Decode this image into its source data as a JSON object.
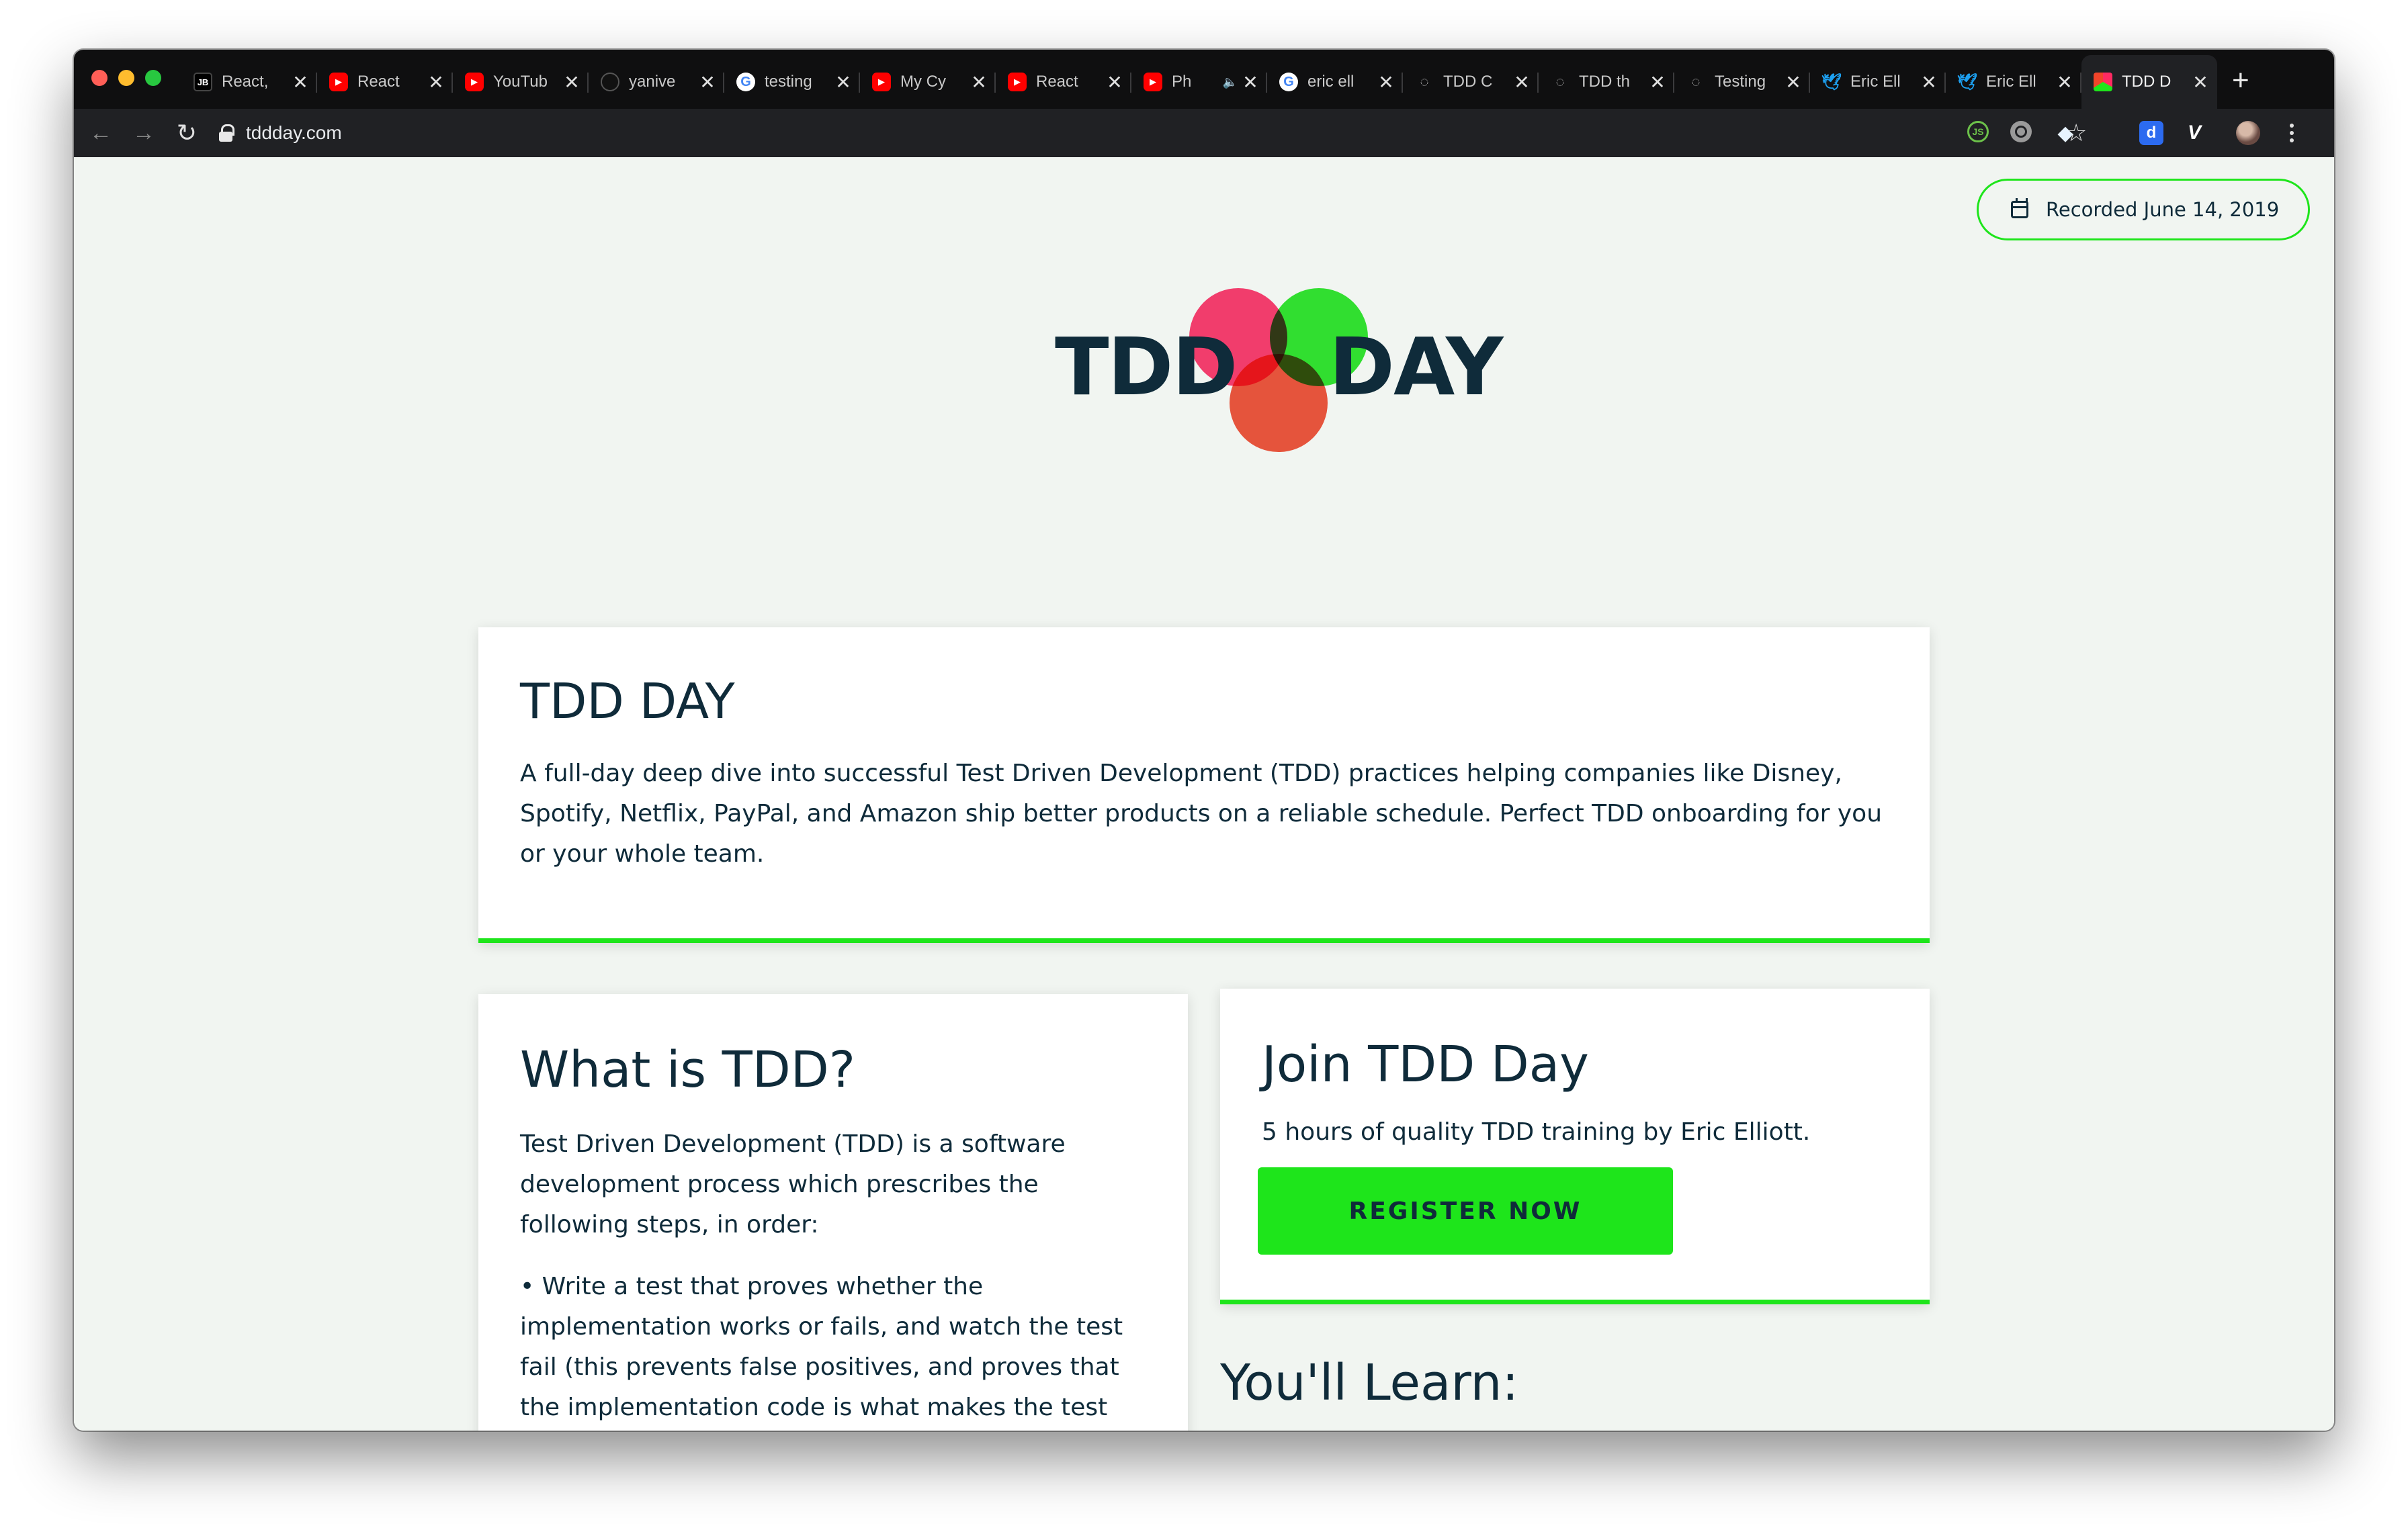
{
  "browser": {
    "tabs": [
      {
        "label": "React,",
        "favicon": "jetbrains-icon",
        "active": false
      },
      {
        "label": "React",
        "favicon": "youtube-icon",
        "active": false
      },
      {
        "label": "YouTub",
        "favicon": "youtube-icon",
        "active": false
      },
      {
        "label": "yanive",
        "favicon": "github-icon",
        "active": false
      },
      {
        "label": "testing",
        "favicon": "google-icon",
        "active": false
      },
      {
        "label": "My Cy",
        "favicon": "youtube-icon",
        "active": false
      },
      {
        "label": "React",
        "favicon": "youtube-icon",
        "active": false
      },
      {
        "label": "Ph",
        "favicon": "youtube-icon",
        "active": false,
        "audio": true
      },
      {
        "label": "eric ell",
        "favicon": "google-icon",
        "active": false
      },
      {
        "label": "TDD C",
        "favicon": "loading-icon",
        "active": false
      },
      {
        "label": "TDD th",
        "favicon": "loading-icon",
        "active": false
      },
      {
        "label": "Testing",
        "favicon": "loading-icon",
        "active": false
      },
      {
        "label": "Eric Ell",
        "favicon": "twitter-icon",
        "active": false
      },
      {
        "label": "Eric Ell",
        "favicon": "twitter-icon",
        "active": false
      },
      {
        "label": "TDD D",
        "favicon": "tdd-day-icon",
        "active": true
      }
    ],
    "tab_close_glyph": "✕",
    "new_tab_glyph": "+",
    "url": "tddday.com",
    "nav": {
      "back": "←",
      "forward": "→",
      "reload": "↻"
    },
    "star_glyph": "☆",
    "extensions": {
      "node": "JS",
      "gem": "◆",
      "d": "d",
      "v": "V"
    }
  },
  "page": {
    "recorded_label": "Recorded June 14, 2019",
    "logo": {
      "left_word": "TDD",
      "right_word": "DAY",
      "colors": {
        "pink": "#ff2a62",
        "green": "#1ee51b",
        "red": "#f2442a"
      }
    },
    "hero": {
      "title": "TDD DAY",
      "text": "A full-day deep dive into successful Test Driven Development (TDD) practices helping companies like Disney, Spotify, Netflix, PayPal, and Amazon ship better products on a reliable schedule. Perfect TDD onboarding for you or your whole team."
    },
    "what": {
      "title": "What is TDD?",
      "intro": "Test Driven Development (TDD) is a software development process which prescribes the following steps, in order:",
      "step1": "• Write a test that proves whether the implementation works or fails, and watch the test fail (this prevents false positives, and proves that the implementation code is what makes the test pass)."
    },
    "join": {
      "title": "Join TDD Day",
      "subtitle": "5 hours of quality TDD training by Eric Elliott.",
      "button": "REGISTER NOW"
    },
    "learn_title": "You'll Learn:",
    "accent_color": "#1ee51b",
    "text_color": "#0f2b3a",
    "background_color": "#f1f5f1"
  }
}
